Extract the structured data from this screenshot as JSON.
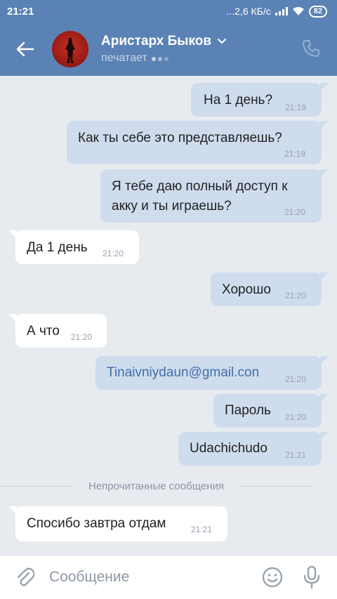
{
  "status": {
    "time": "21:21",
    "speed": "...2,6 КБ/с",
    "battery": "82"
  },
  "header": {
    "contact_name": "Аристарх Быков",
    "status_text": "печатает",
    "icons": [
      "back-arrow-icon",
      "chevron-down-icon",
      "phone-icon"
    ]
  },
  "messages": [
    {
      "dir": "out",
      "text": "На 1 день?",
      "time": "21:19"
    },
    {
      "dir": "out",
      "text": "Как ты себе это представляешь?",
      "time": "21:19"
    },
    {
      "dir": "out",
      "line1": "Я тебе даю полный доступ к",
      "line2": "акку и ты играешь?",
      "time": "21:20"
    },
    {
      "dir": "in",
      "text": "Да 1 день",
      "time": "21:20"
    },
    {
      "dir": "out",
      "text": "Хорошо",
      "time": "21:20"
    },
    {
      "dir": "in",
      "text": "А что",
      "time": "21:20"
    },
    {
      "dir": "out",
      "text": "Tinaivniydaun@gmail.con",
      "time": "21:20"
    },
    {
      "dir": "out",
      "text": "Пароль",
      "time": "21:20"
    },
    {
      "dir": "out",
      "text": "Udachichudo",
      "time": "21:21"
    },
    {
      "dir": "in",
      "text": "Спосибо завтра отдам",
      "time": "21:21"
    }
  ],
  "unread_divider": "Непрочитанные сообщения",
  "composer": {
    "placeholder": "Сообщение",
    "icons": [
      "paperclip-icon",
      "smile-icon",
      "microphone-icon"
    ]
  },
  "colors": {
    "header_bg": "#5b82b4",
    "outgoing_bubble": "#cfdcee",
    "incoming_bubble": "#ffffff",
    "chat_bg": "#e7ebf0",
    "link": "#3f6fa8"
  }
}
